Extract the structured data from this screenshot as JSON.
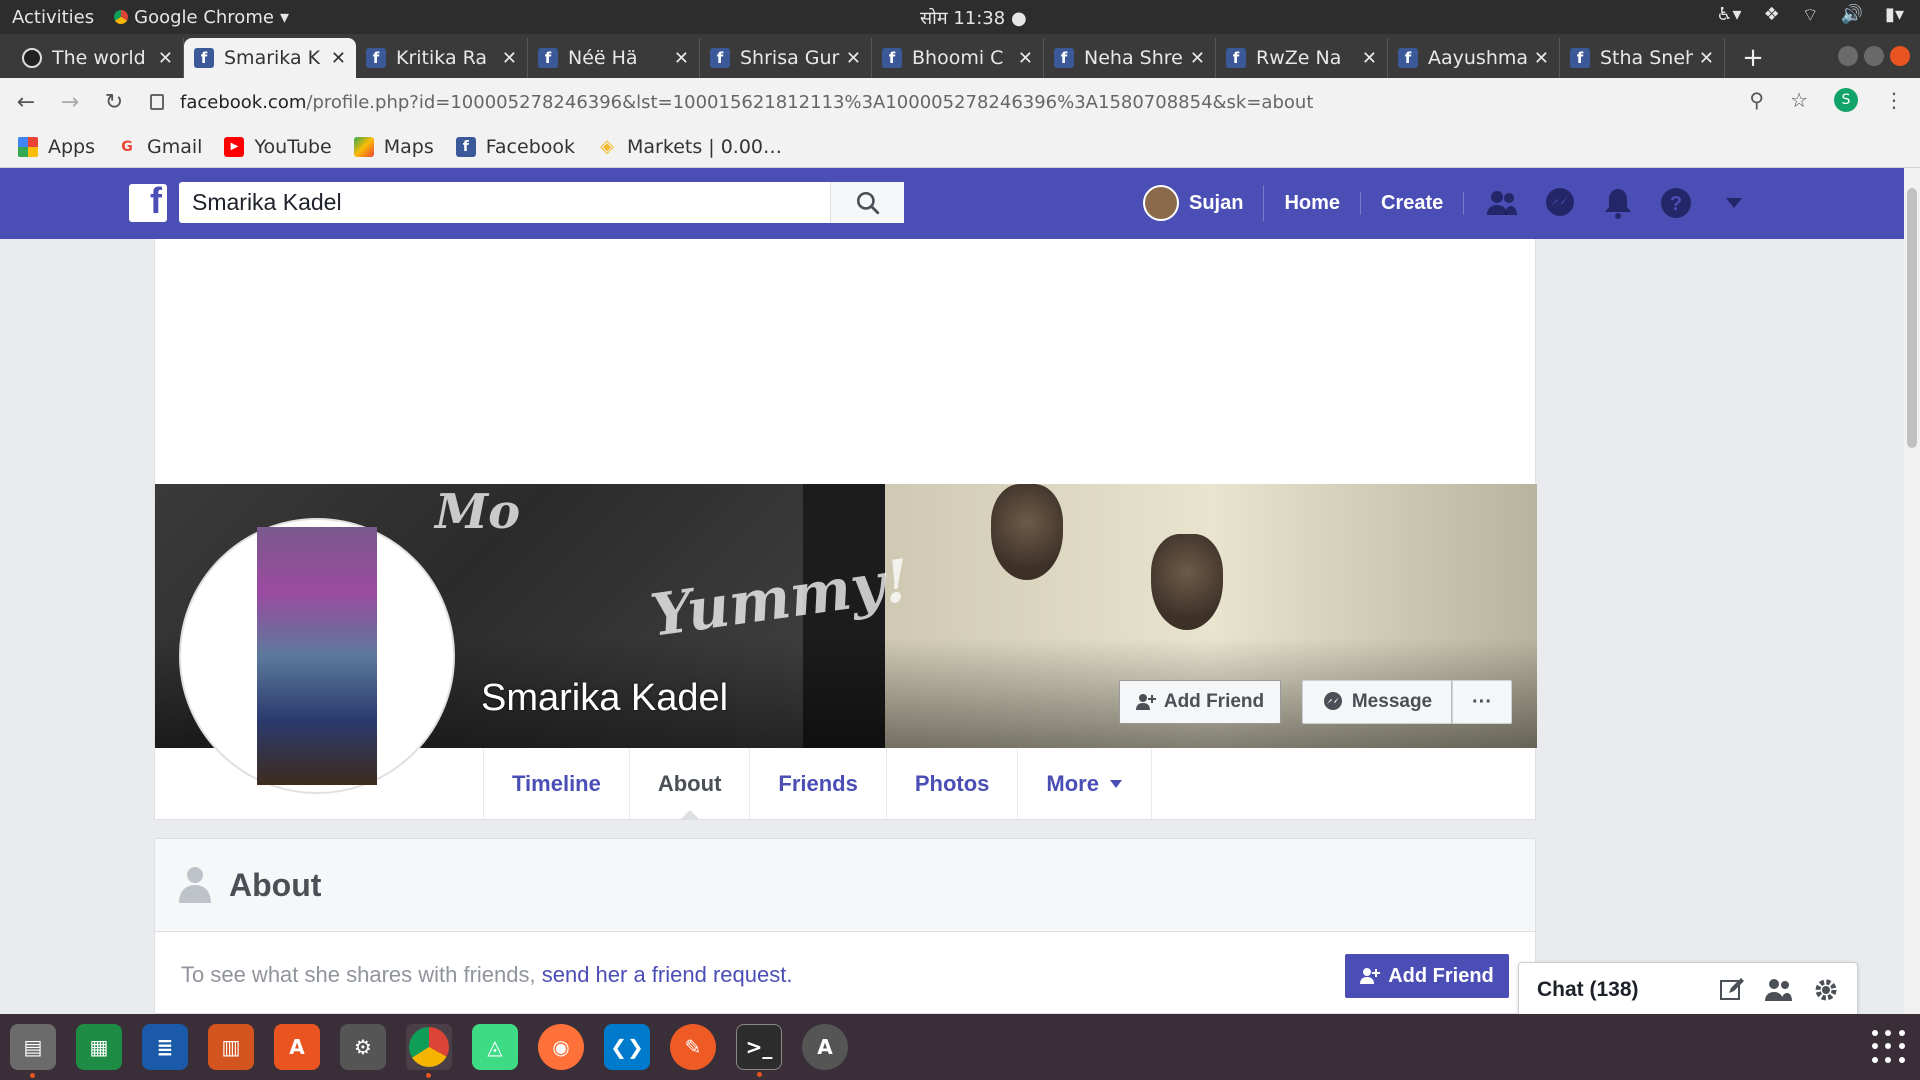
{
  "system_bar": {
    "activities": "Activities",
    "app_name": "Google Chrome",
    "clock": "सोम 11:38"
  },
  "tabs": [
    {
      "title": "The world",
      "icon": "github-icon",
      "active": false
    },
    {
      "title": "Smarika K",
      "icon": "facebook-icon",
      "active": true
    },
    {
      "title": "Kritika Ra",
      "icon": "facebook-icon",
      "active": false
    },
    {
      "title": "Néë Hä",
      "icon": "facebook-icon",
      "active": false
    },
    {
      "title": "Shrisa Gur",
      "icon": "facebook-icon",
      "active": false
    },
    {
      "title": "Bhoomi C",
      "icon": "facebook-icon",
      "active": false
    },
    {
      "title": "Neha Shre",
      "icon": "facebook-icon",
      "active": false
    },
    {
      "title": "RwZe Na",
      "icon": "facebook-icon",
      "active": false
    },
    {
      "title": "Aayushma",
      "icon": "facebook-icon",
      "active": false
    },
    {
      "title": "Stha Sneh",
      "icon": "facebook-icon",
      "active": false
    }
  ],
  "address_bar": {
    "domain": "facebook.com",
    "path": "/profile.php?id=100005278246396&lst=100015621812113%3A100005278246396%3A1580708854&sk=about",
    "profile_initial": "S"
  },
  "bookmarks": [
    {
      "label": "Apps",
      "icon": "apps-grid-icon"
    },
    {
      "label": "Gmail",
      "icon": "google-icon"
    },
    {
      "label": "YouTube",
      "icon": "youtube-icon"
    },
    {
      "label": "Maps",
      "icon": "maps-icon"
    },
    {
      "label": "Facebook",
      "icon": "facebook-icon"
    },
    {
      "label": "Markets | 0.00…",
      "icon": "binance-icon"
    }
  ],
  "fb_header": {
    "search_value": "Smarika Kadel",
    "user_name": "Sujan",
    "home": "Home",
    "create": "Create"
  },
  "profile": {
    "name": "Smarika Kadel",
    "add_friend": "Add Friend",
    "message": "Message",
    "more_dots": "···",
    "tabs": [
      "Timeline",
      "About",
      "Friends",
      "Photos",
      "More"
    ],
    "active_tab": "About"
  },
  "about": {
    "title": "About",
    "body_prefix": "To see what she shares with friends, ",
    "body_link": "send her a friend request.",
    "add_friend": "Add Friend"
  },
  "chat": {
    "label": "Chat (138)"
  },
  "colors": {
    "facebook_blue": "#4b4fb5",
    "ubuntu_orange": "#e95420"
  },
  "dock_apps": [
    "files-icon",
    "spreadsheet-icon",
    "writer-icon",
    "impress-icon",
    "software-center-icon",
    "settings-icon",
    "chrome-icon",
    "android-studio-icon",
    "firefox-icon",
    "vscode-icon",
    "postman-icon",
    "terminal-icon",
    "update-manager-icon"
  ]
}
